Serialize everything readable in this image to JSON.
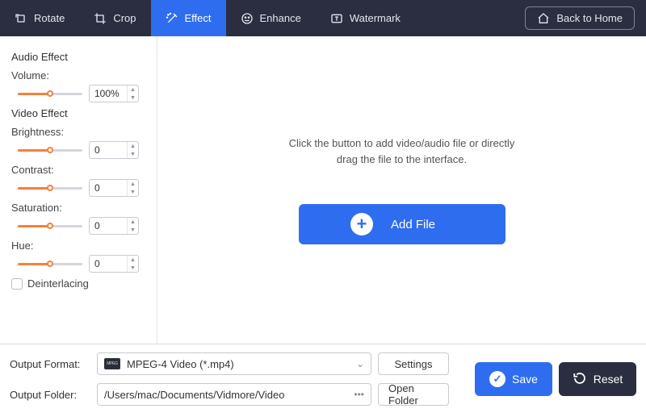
{
  "topbar": {
    "items": [
      {
        "label": "Rotate",
        "icon": "rotate-icon",
        "active": false
      },
      {
        "label": "Crop",
        "icon": "crop-icon",
        "active": false
      },
      {
        "label": "Effect",
        "icon": "effect-icon",
        "active": true
      },
      {
        "label": "Enhance",
        "icon": "enhance-icon",
        "active": false
      },
      {
        "label": "Watermark",
        "icon": "watermark-icon",
        "active": false
      }
    ],
    "back_label": "Back to Home"
  },
  "sidebar": {
    "audio": {
      "title": "Audio Effect",
      "volume_label": "Volume:",
      "volume_value": "100%",
      "volume_fill_pct": 50
    },
    "video": {
      "title": "Video Effect",
      "controls": [
        {
          "label": "Brightness:",
          "value": "0",
          "fill_pct": 50
        },
        {
          "label": "Contrast:",
          "value": "0",
          "fill_pct": 50
        },
        {
          "label": "Saturation:",
          "value": "0",
          "fill_pct": 50
        },
        {
          "label": "Hue:",
          "value": "0",
          "fill_pct": 50
        }
      ],
      "deinterlacing_label": "Deinterlacing",
      "deinterlacing_checked": false
    }
  },
  "canvas": {
    "hint": "Click the button to add video/audio file or directly\ndrag the file to the interface.",
    "add_label": "Add File"
  },
  "bottom": {
    "format_label": "Output Format:",
    "format_value": "MPEG-4 Video (*.mp4)",
    "settings_label": "Settings",
    "folder_label": "Output Folder:",
    "folder_value": "/Users/mac/Documents/Vidmore/Video",
    "open_folder_label": "Open Folder",
    "save_label": "Save",
    "reset_label": "Reset"
  }
}
